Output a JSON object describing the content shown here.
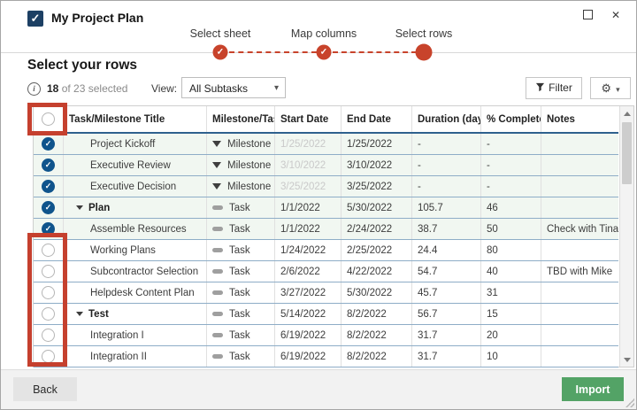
{
  "window": {
    "title": "My Project Plan",
    "logo_glyph": "✓",
    "close_glyph": "✕"
  },
  "stepper": {
    "steps": [
      {
        "label": "Select sheet",
        "state": "done"
      },
      {
        "label": "Map columns",
        "state": "done"
      },
      {
        "label": "Select rows",
        "state": "current"
      }
    ],
    "check_glyph": "✓"
  },
  "section": {
    "heading": "Select your rows",
    "selected_count": "18",
    "selected_suffix": "of 23 selected",
    "info_glyph": "i",
    "view_label": "View:",
    "view_value": "All Subtasks",
    "filter_label": "Filter",
    "gear_glyph": "⚙",
    "caret_glyph": "▾"
  },
  "table": {
    "columns": [
      "Task/Milestone Title",
      "Milestone/Task",
      "Start Date",
      "End Date",
      "Duration (days)",
      "% Complete",
      "Notes"
    ],
    "rows": [
      {
        "title": "Project Kickoff",
        "checked": true,
        "parent": false,
        "level": 1,
        "type": "Milestone",
        "start": "1/25/2022",
        "start_muted": true,
        "end": "1/25/2022",
        "duration": "-",
        "complete": "-",
        "notes": ""
      },
      {
        "title": "Executive Review",
        "checked": true,
        "parent": false,
        "level": 1,
        "type": "Milestone",
        "start": "3/10/2022",
        "start_muted": true,
        "end": "3/10/2022",
        "duration": "-",
        "complete": "-",
        "notes": ""
      },
      {
        "title": "Executive Decision",
        "checked": true,
        "parent": false,
        "level": 1,
        "type": "Milestone",
        "start": "3/25/2022",
        "start_muted": true,
        "end": "3/25/2022",
        "duration": "-",
        "complete": "-",
        "notes": ""
      },
      {
        "title": "Plan",
        "checked": true,
        "parent": true,
        "level": 0,
        "type": "Task",
        "start": "1/1/2022",
        "start_muted": false,
        "end": "5/30/2022",
        "duration": "105.7",
        "complete": "46",
        "notes": ""
      },
      {
        "title": "Assemble Resources",
        "checked": true,
        "parent": false,
        "level": 1,
        "type": "Task",
        "start": "1/1/2022",
        "start_muted": false,
        "end": "2/24/2022",
        "duration": "38.7",
        "complete": "50",
        "notes": "Check with Tina"
      },
      {
        "title": "Working Plans",
        "checked": false,
        "parent": false,
        "level": 1,
        "type": "Task",
        "start": "1/24/2022",
        "start_muted": false,
        "end": "2/25/2022",
        "duration": "24.4",
        "complete": "80",
        "notes": ""
      },
      {
        "title": "Subcontractor Selection",
        "checked": false,
        "parent": false,
        "level": 1,
        "type": "Task",
        "start": "2/6/2022",
        "start_muted": false,
        "end": "4/22/2022",
        "duration": "54.7",
        "complete": "40",
        "notes": "TBD with Mike"
      },
      {
        "title": "Helpdesk Content Plan",
        "checked": false,
        "parent": false,
        "level": 1,
        "type": "Task",
        "start": "3/27/2022",
        "start_muted": false,
        "end": "5/30/2022",
        "duration": "45.7",
        "complete": "31",
        "notes": ""
      },
      {
        "title": "Test",
        "checked": false,
        "parent": true,
        "level": 0,
        "type": "Task",
        "start": "5/14/2022",
        "start_muted": false,
        "end": "8/2/2022",
        "duration": "56.7",
        "complete": "15",
        "notes": ""
      },
      {
        "title": "Integration I",
        "checked": false,
        "parent": false,
        "level": 1,
        "type": "Task",
        "start": "6/19/2022",
        "start_muted": false,
        "end": "8/2/2022",
        "duration": "31.7",
        "complete": "20",
        "notes": ""
      },
      {
        "title": "Integration II",
        "checked": false,
        "parent": false,
        "level": 1,
        "type": "Task",
        "start": "6/19/2022",
        "start_muted": false,
        "end": "8/2/2022",
        "duration": "31.7",
        "complete": "10",
        "notes": ""
      }
    ],
    "checked_overrides_note": "",
    "checkbox_check_glyph": "✓"
  },
  "footer": {
    "back_label": "Back",
    "import_label": "Import"
  },
  "colors": {
    "stepper_accent": "#c8432b",
    "annotation_red": "#c5402e",
    "checkbox_blue": "#0f548c",
    "selected_row_green": "#f1f7f1",
    "row_border_blue": "#8eadc7",
    "header_border_blue": "#2f618e",
    "import_green": "#53a366",
    "logo_navy": "#1d4064"
  }
}
